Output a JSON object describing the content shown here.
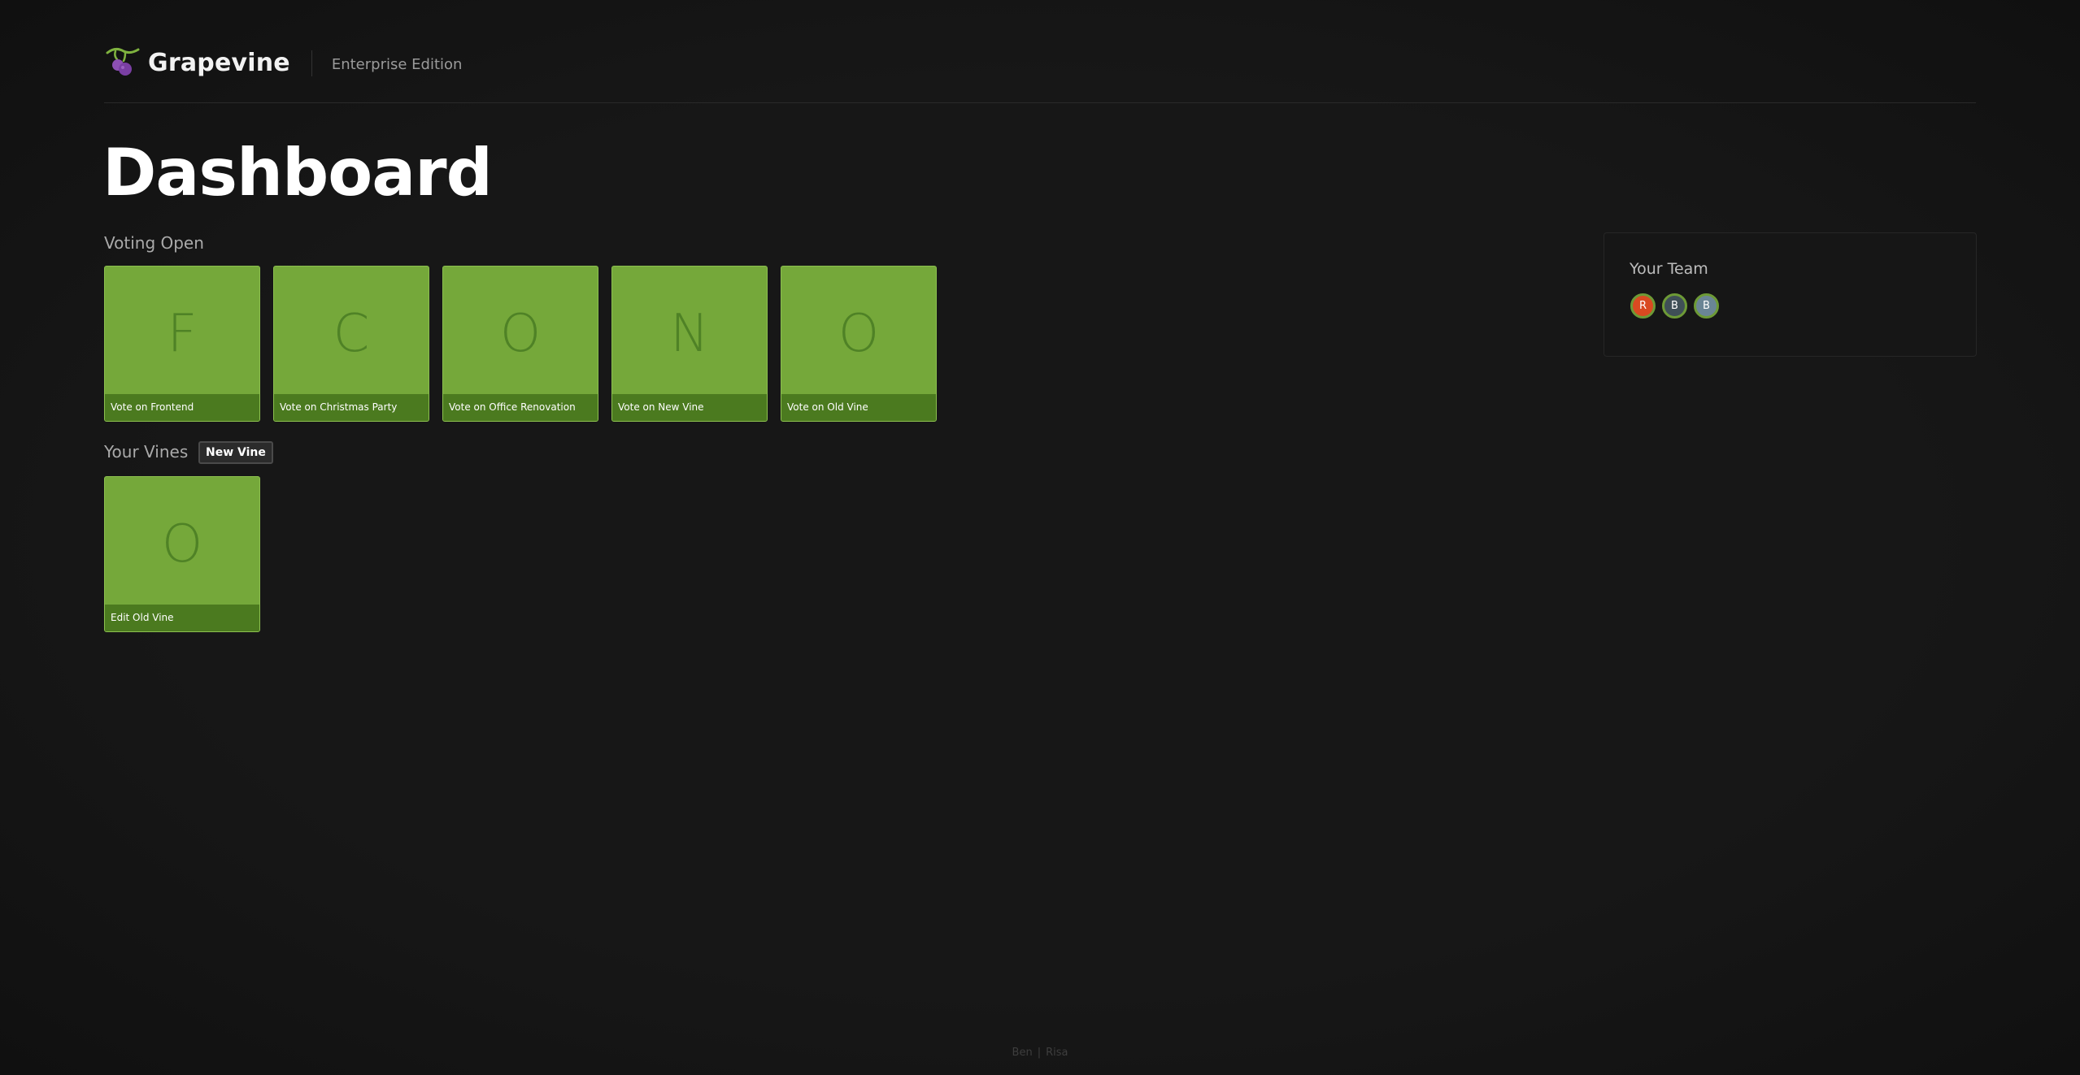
{
  "header": {
    "brand": "Grapevine",
    "edition": "Enterprise Edition"
  },
  "page_title": "Dashboard",
  "voting": {
    "label": "Voting Open",
    "tiles": [
      {
        "letter": "F",
        "caption": "Vote on Frontend"
      },
      {
        "letter": "C",
        "caption": "Vote on Christmas Party"
      },
      {
        "letter": "O",
        "caption": "Vote on Office Renovation"
      },
      {
        "letter": "N",
        "caption": "Vote on New Vine"
      },
      {
        "letter": "O",
        "caption": "Vote on Old Vine"
      }
    ]
  },
  "vines": {
    "label": "Your Vines",
    "new_button": "New Vine",
    "tiles": [
      {
        "letter": "O",
        "caption": "Edit Old Vine"
      }
    ]
  },
  "team": {
    "title": "Your Team",
    "members": [
      {
        "initial": "R",
        "color": "#d94a21"
      },
      {
        "initial": "B",
        "color": "#3f4f57"
      },
      {
        "initial": "B",
        "color": "#6a8595"
      }
    ]
  },
  "footer": {
    "left": "Ben",
    "separator": "|",
    "right": "Risa"
  },
  "colors": {
    "background": "#161616",
    "tile": "#75a83a",
    "tile_caption": "#4b7a1f",
    "tile_letter": "#4f8226"
  },
  "icons": {
    "logo": "grape-vine-icon"
  }
}
